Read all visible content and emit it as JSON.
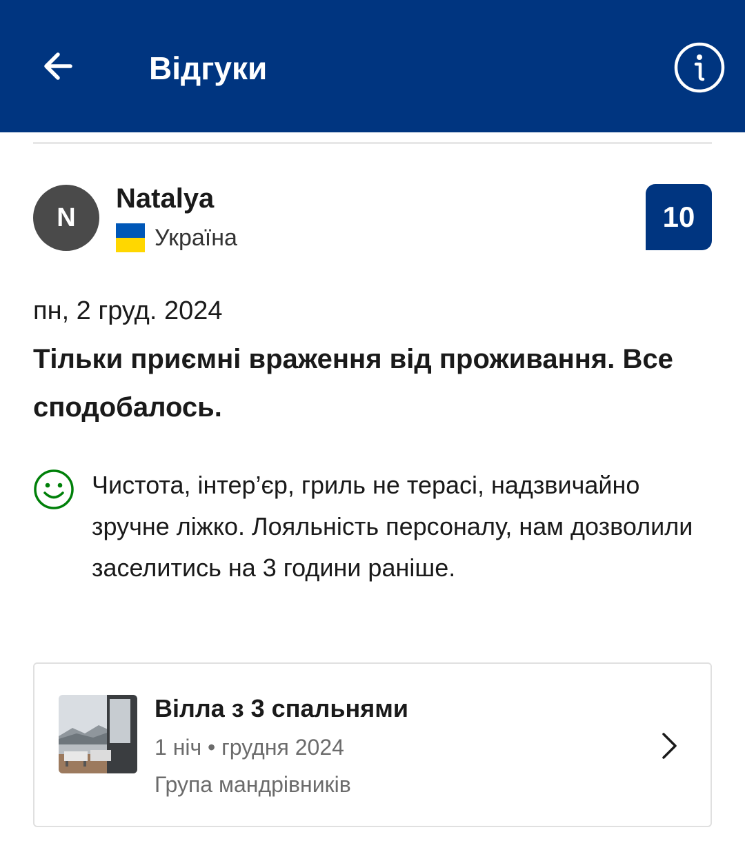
{
  "app_bar": {
    "title": "Відгуки",
    "back_icon": "arrow-left-icon",
    "info_icon": "info-icon",
    "background": "#003580"
  },
  "review": {
    "avatar_initial": "N",
    "reviewer_name": "Natalya",
    "country": "Україна",
    "flag_icon": "ukraine-flag-icon",
    "score": "10",
    "date": "пн, 2 груд. 2024",
    "headline": "Тільки приємні враження від проживання. Все сподобалось.",
    "positive_icon": "smiley-icon",
    "positive_color": "#008009",
    "positive_text": "Чистота, інтер’єр, гриль не терасі, надзвичайно зручне ліжко. Лояльність персоналу, нам дозволили заселитись на 3 години раніше."
  },
  "room_card": {
    "name": "Вілла з 3 спальнями",
    "stay": "1 ніч • грудня 2024",
    "traveler_type": "Група мандрівників",
    "chevron_icon": "chevron-right-icon"
  }
}
